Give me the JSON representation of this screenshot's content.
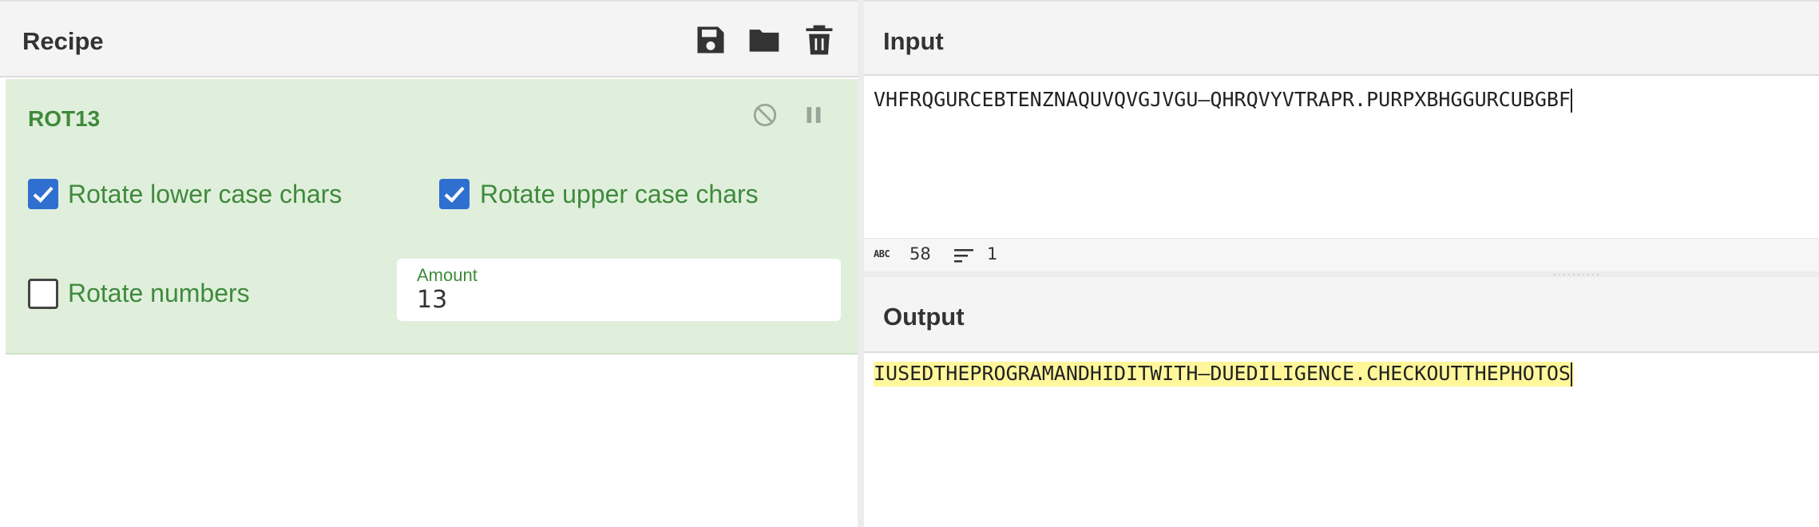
{
  "recipe": {
    "title": "Recipe",
    "toolbar": {
      "save_icon": "save-icon",
      "open_icon": "folder-icon",
      "clear_icon": "trash-icon"
    },
    "operation": {
      "name": "ROT13",
      "options": {
        "rotate_lower_label": "Rotate lower case chars",
        "rotate_lower_checked": true,
        "rotate_upper_label": "Rotate upper case chars",
        "rotate_upper_checked": true,
        "rotate_numbers_label": "Rotate numbers",
        "rotate_numbers_checked": false,
        "amount_label": "Amount",
        "amount_value": "13"
      }
    }
  },
  "input": {
    "title": "Input",
    "text": "VHFRQGURCEBTENZNAQUVQVGJVGU—QHRQVYVTRAPR.PURPXBHGGURCUBGBF",
    "status": {
      "length": "58",
      "lines": "1"
    }
  },
  "output": {
    "title": "Output",
    "text": "IUSEDTHEPROGRAMANDHIDITWITH—DUEDILIGENCE.CHECKOUTTHEPHOTOS"
  },
  "colors": {
    "operation_bg": "#e0efdc",
    "operation_text": "#3f8a3c",
    "checkbox_on": "#2f6fd0",
    "highlight": "#fff79a"
  }
}
